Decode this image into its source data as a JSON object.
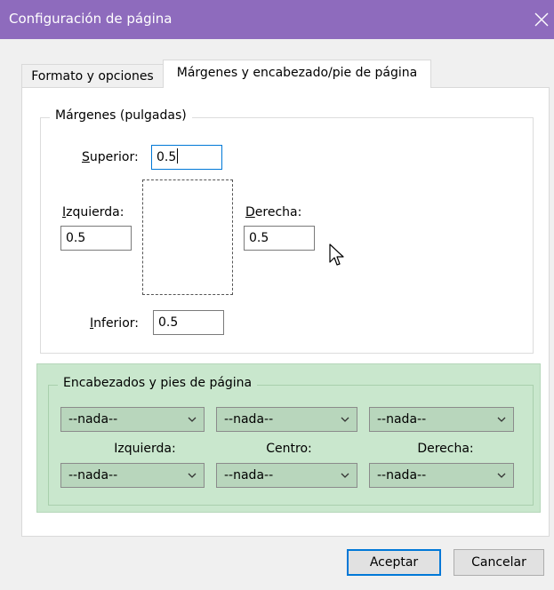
{
  "window": {
    "title": "Configuración de página"
  },
  "tabs": [
    {
      "label": "Formato y opciones",
      "active": false
    },
    {
      "label": "Márgenes y encabezado/pie de página",
      "active": true
    }
  ],
  "margins": {
    "legend": "Márgenes (pulgadas)",
    "top": {
      "label_accel": "S",
      "label_rest": "uperior:",
      "value": "0.5"
    },
    "left": {
      "label_accel": "I",
      "label_rest": "zquierda:",
      "value": "0.5"
    },
    "right": {
      "label_accel": "D",
      "label_rest": "erecha:",
      "value": "0.5"
    },
    "bottom": {
      "label_accel": "I",
      "label_rest": "nferior:",
      "value": "0.5"
    }
  },
  "headers_footers": {
    "legend": "Encabezados y pies de página",
    "headers": [
      "--nada--",
      "--nada--",
      "--nada--"
    ],
    "footers": [
      "--nada--",
      "--nada--",
      "--nada--"
    ],
    "column_labels": [
      "Izquierda:",
      "Centro:",
      "Derecha:"
    ],
    "background_color": "#c9e7cd"
  },
  "buttons": {
    "ok": "Aceptar",
    "cancel": "Cancelar"
  },
  "colors": {
    "titlebar": "#8e6bbd",
    "focus": "#0078d7"
  }
}
